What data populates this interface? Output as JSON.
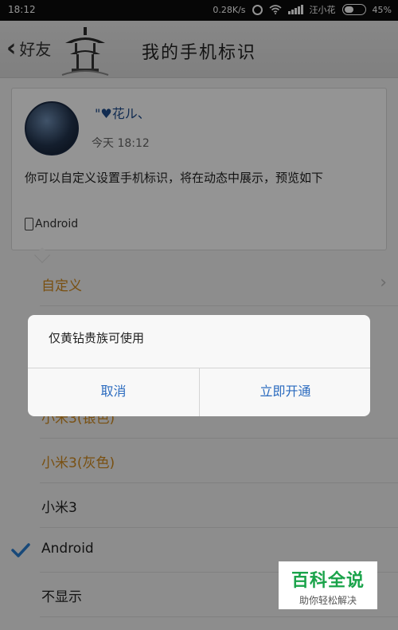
{
  "status_bar": {
    "time": "18:12",
    "network_speed": "0.28K/s",
    "carrier": "汪小花",
    "battery": "45%"
  },
  "nav": {
    "back_label": "好友",
    "title": "我的手机标识"
  },
  "card": {
    "username": "\"♥花ル、",
    "post_time": "今天 18:12",
    "description": "你可以自定义设置手机标识，将在动态中展示，预览如下",
    "device_label": "Android"
  },
  "options": [
    {
      "label": "自定义",
      "style": "orange",
      "selected": false
    },
    {
      "label": "小米3(银色)",
      "style": "orange",
      "selected": false
    },
    {
      "label": "小米3(灰色)",
      "style": "orange",
      "selected": false
    },
    {
      "label": "小米3",
      "style": "normal",
      "selected": false
    },
    {
      "label": "Android",
      "style": "normal",
      "selected": true
    },
    {
      "label": "不显示",
      "style": "normal",
      "selected": false
    }
  ],
  "dialog": {
    "message": "仅黄钻贵族可使用",
    "cancel_label": "取消",
    "confirm_label": "立即开通"
  },
  "watermark": {
    "title": "百科全说",
    "subtitle": "助你轻松解决"
  },
  "colors": {
    "accent_blue": "#2b6bbf",
    "option_orange": "#d08a1e",
    "check_blue": "#2a7fd0",
    "watermark_green": "#1aa34a"
  }
}
